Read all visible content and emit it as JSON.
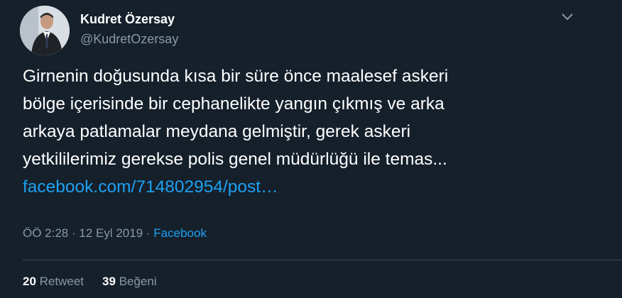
{
  "author": {
    "name": "Kudret Özersay",
    "handle": "@KudretOzersay"
  },
  "tweet": {
    "lines": [
      "Girnenin doğusunda kısa bir süre önce maalesef askeri",
      "bölge içerisinde bir cephanelikte yangın çıkmış ve arka",
      "arkaya patlamalar meydana gelmiştir, gerek askeri",
      "yetkililerimiz gerekse polis genel müdürlüğü ile temas..."
    ],
    "link_text": "facebook.com/714802954/post…"
  },
  "meta": {
    "time": "ÖÖ 2:28",
    "separator": " · ",
    "date": "12 Eyl 2019",
    "source": "Facebook"
  },
  "stats": {
    "retweets_count": "20",
    "retweets_label": "Retweet",
    "likes_count": "39",
    "likes_label": "Beğeni"
  },
  "icons": {
    "menu": "chevron-down-icon"
  },
  "colors": {
    "background": "#15202b",
    "text": "#ffffff",
    "secondary": "#8899a6",
    "accent": "#1da1f2",
    "divider": "#38444d"
  }
}
